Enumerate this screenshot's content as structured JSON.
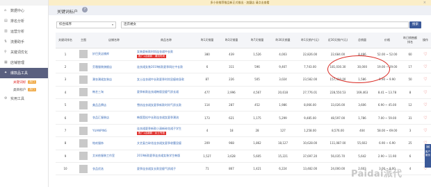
{
  "topbar": {
    "notice": "多小份推荐推品新正式推出 · 加盟店 请点击查看",
    "close": "×"
  },
  "sidebar": {
    "items": [
      {
        "label": "数据中心",
        "icon": "home-icon"
      },
      {
        "label": "排名分析",
        "icon": "chart-icon"
      },
      {
        "label": "运营分析",
        "icon": "analysis-icon"
      },
      {
        "label": "流量助手",
        "icon": "traffic-icon"
      },
      {
        "label": "关键词优化",
        "icon": "keyword-icon"
      },
      {
        "label": "店铺管理",
        "icon": "store-icon"
      },
      {
        "label": "爆款品工具",
        "icon": "fire-icon"
      }
    ],
    "sub_items": [
      {
        "label": "关键词标",
        "badge": "热门"
      },
      {
        "label": "类目标户",
        "badge": "热门"
      }
    ],
    "last_item": {
      "label": "实用工具",
      "icon": "tool-icon"
    }
  },
  "header": {
    "title": "关键词标户",
    "help": "?"
  },
  "filter": {
    "select_value": "综合排序",
    "search_value": "连衣裙女",
    "search_button": "搜索"
  },
  "table": {
    "headers": [
      "关键词排名",
      "主图",
      "店铺名称",
      "商品名称",
      "昨1天销量",
      "昨3天销量",
      "昨7天销量",
      "昨30天销量",
      "昨1天销户(元)",
      "近30天销户(元)",
      "总销量",
      "价格",
      "昨日销售额排名",
      "操作"
    ],
    "rows": [
      {
        "rank": "1",
        "store": "妙巴芙店铺库",
        "name": "女装夏新款时尚连衣裙中长款",
        "tag": "推广1店新款 · 潮流时尚",
        "d1": "380",
        "d3": "439",
        "d7": "1,526",
        "d30": "4,003",
        "m1": "22,826.00",
        "m30": "22,684.00",
        "total": "8,486",
        "price": "52.00 ~ 52.00",
        "extra": "60"
      },
      {
        "rank": "2",
        "store": "芬雅服装旗舰店",
        "name": "连衣裙女装2019新款夏季网红中长款",
        "tag": "",
        "d1": "6",
        "d3": "311",
        "d7": "596",
        "d30": "9,467",
        "m1": "7,743.00",
        "m30": "181,030.30",
        "total": "30,000",
        "price": "19.00 ~ 29.00",
        "extra": "17"
      },
      {
        "rank": "3",
        "store": "潮衣潮裙女装店",
        "name": "女士连衣裙中长款夏季时尚显瘦修身款",
        "tag": "",
        "d1": "87",
        "d3": "226",
        "d7": "505",
        "d30": "3,024",
        "m1": "23,582.00",
        "m30": "157,410.00",
        "total": "1,586",
        "price": "9.90 ~ 9.90",
        "extra": "50"
      },
      {
        "rank": "4",
        "store": "韩艺三淘",
        "name": "夏季新款连衣裙韩版显瘦气质长裙",
        "tag": "",
        "d1": "477",
        "d3": "2,996",
        "d7": "4,567",
        "d30": "20,618",
        "m1": "27,776.01",
        "m30": "228,550.53",
        "total": "169,463",
        "price": "8.41 ~ 13.78",
        "extra": "8"
      },
      {
        "rank": "5",
        "store": "美品品牌店",
        "name": "雪纺连衣裙女夏季新款时尚气质长款",
        "tag": "",
        "d1": "114",
        "d3": "287",
        "d7": "452",
        "d30": "1,986",
        "m1": "8,066.00",
        "m30": "33,026.00",
        "total": "3,606",
        "price": "6.90 ~ 45.00",
        "extra": "12"
      },
      {
        "rank": "6",
        "store": "衣品汇服装店",
        "name": "韩版宽松中长款连衣裙女夏季潮流",
        "tag": "",
        "d1": "173",
        "d3": "621",
        "d7": "1,175",
        "d30": "5,299",
        "m1": "9,485.00",
        "m30": "48,597.00",
        "total": "1,786",
        "price": "7.00 ~ 59.00",
        "extra": "31"
      },
      {
        "rank": "7",
        "store": "YUANPING",
        "name": "连衣裙夏季新款小清新碎花裙子学生",
        "tag": "推广1店新款 · 女士专柜",
        "d1": "4",
        "d3": "18",
        "d7": "28",
        "d30": "127",
        "m1": "1,258.00",
        "m30": "8,576.00",
        "total": "404",
        "price": "58.00 ~ 69.00",
        "extra": "3"
      },
      {
        "rank": "8",
        "store": "帕欢服饰",
        "name": "文艺复古碎花连衣裙女夏季收腰显瘦",
        "tag": "",
        "d1": "209",
        "d3": "968",
        "d7": "1,862",
        "d30": "18,127",
        "m1": "10,628.00",
        "m30": "111,087.00",
        "total": "55,602",
        "price": "6.90 ~ 6.90",
        "extra": "25"
      },
      {
        "rank": "9",
        "store": "艾米依服装工作室",
        "name": "2019新款夏季连衣裙女装学生韩版",
        "tag": "",
        "d1": "1,527",
        "d3": "3,628",
        "d7": "5,605",
        "d30": "15,221",
        "m1": "37,697.20",
        "m30": "56,035.70",
        "total": "5,642",
        "price": "2.90 ~ 11.90",
        "extra": "6"
      },
      {
        "rank": "10",
        "store": "衣品优选",
        "name": "夏季连衣裙女长款显瘦气质裙子",
        "tag": "",
        "d1": "71",
        "d3": "867",
        "d7": "1,421",
        "d30": "6,224",
        "m1": "13,482.00",
        "m30": "24,000.00",
        "total": "2,603",
        "price": "3.00 ~ 8.00",
        "extra": "4"
      }
    ]
  },
  "float": {
    "icon": "chat-icon",
    "label": "客户服务"
  },
  "watermark": "Paidai派代"
}
